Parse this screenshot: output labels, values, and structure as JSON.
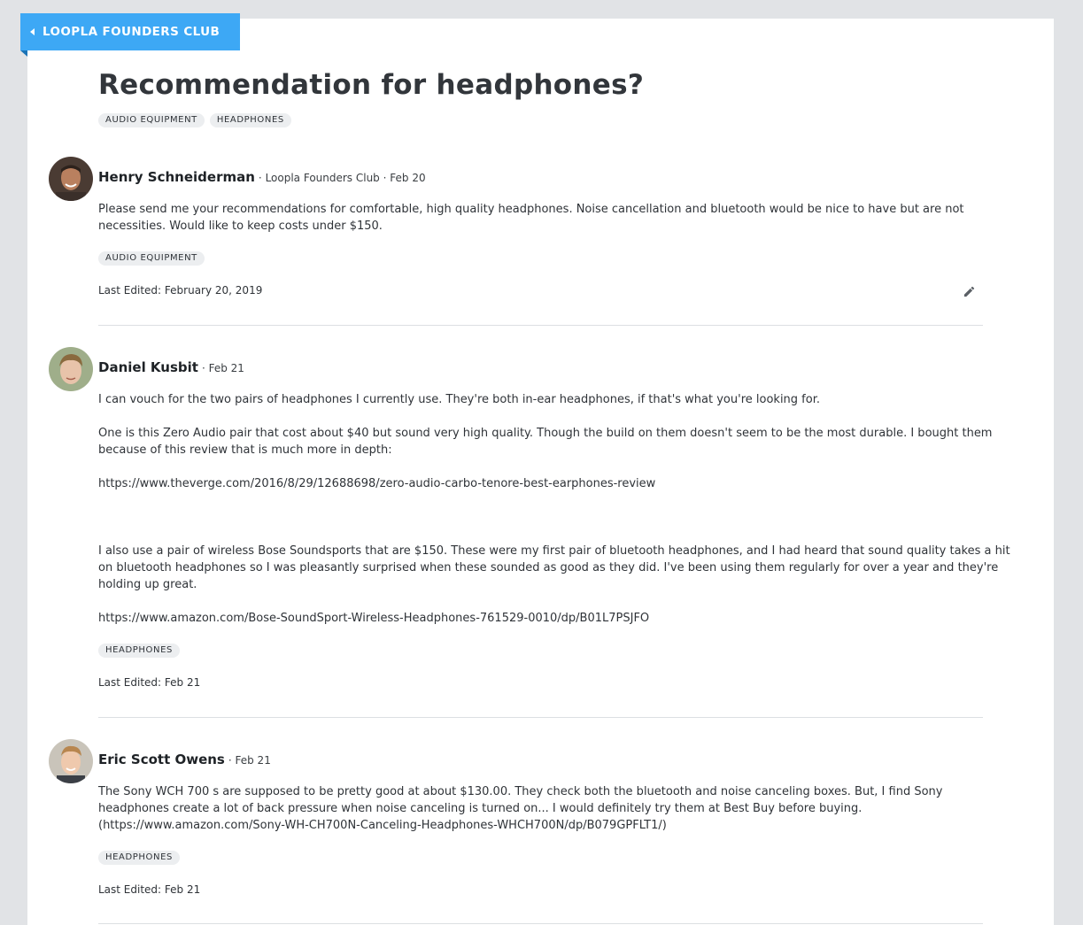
{
  "club_ribbon": {
    "label": "LOOPLA FOUNDERS CLUB",
    "icon": "caret-left-icon",
    "color": "#3da8f5"
  },
  "thread": {
    "title": "Recommendation for headphones?",
    "tags": [
      "AUDIO EQUIPMENT",
      "HEADPHONES"
    ]
  },
  "posts": [
    {
      "author": "Henry Schneiderman",
      "club": "Loopla Founders Club",
      "date": "Feb 20",
      "paragraphs": [
        "Please send me your recommendations for comfortable, high quality headphones. Noise cancellation and bluetooth would be nice to have but are not",
        "necessities. Would like to keep costs under $150."
      ],
      "tags": [
        "AUDIO EQUIPMENT"
      ],
      "last_edited": "Last Edited: February 20, 2019",
      "edit_icon": "pencil-icon"
    },
    {
      "author": "Daniel Kusbit",
      "date": "Feb 21",
      "paragraphs": [
        "I can vouch for the two pairs of headphones I currently use.  They're both in-ear headphones, if that's what you're looking for.",
        "One is this Zero Audio pair that cost about $40 but sound very high quality.  Though the build on them doesn't seem to be the most durable.  I bought them",
        "because of this review that is much more in depth:",
        "https://www.theverge.com/2016/8/29/12688698/zero-audio-carbo-tenore-best-earphones-review",
        "I also use a pair of wireless Bose Soundsports that are $150.  These were my first pair of bluetooth headphones, and I had heard that sound quality takes a hit",
        "on bluetooth headphones so I was pleasantly surprised when these sounded as good as they did.  I've been using them regularly for over a year and they're",
        "holding up great.",
        "https://www.amazon.com/Bose-SoundSport-Wireless-Headphones-761529-0010/dp/B01L7PSJFO"
      ],
      "tags": [
        "HEADPHONES"
      ],
      "last_edited": "Last Edited: Feb 21"
    },
    {
      "author": "Eric Scott Owens",
      "date": "Feb 21",
      "paragraphs": [
        "The Sony WCH 700 s are supposed to be pretty good at about $130.00. They check both the bluetooth and noise canceling boxes. But, I find Sony",
        "headphones create a lot of back pressure when noise canceling is turned on... I would definitely try them at Best Buy before buying.",
        "(https://www.amazon.com/Sony-WH-CH700N-Canceling-Headphones-WHCH700N/dp/B079GPFLT1/)"
      ],
      "tags": [
        "HEADPHONES"
      ],
      "last_edited": "Last Edited: Feb 21"
    }
  ]
}
